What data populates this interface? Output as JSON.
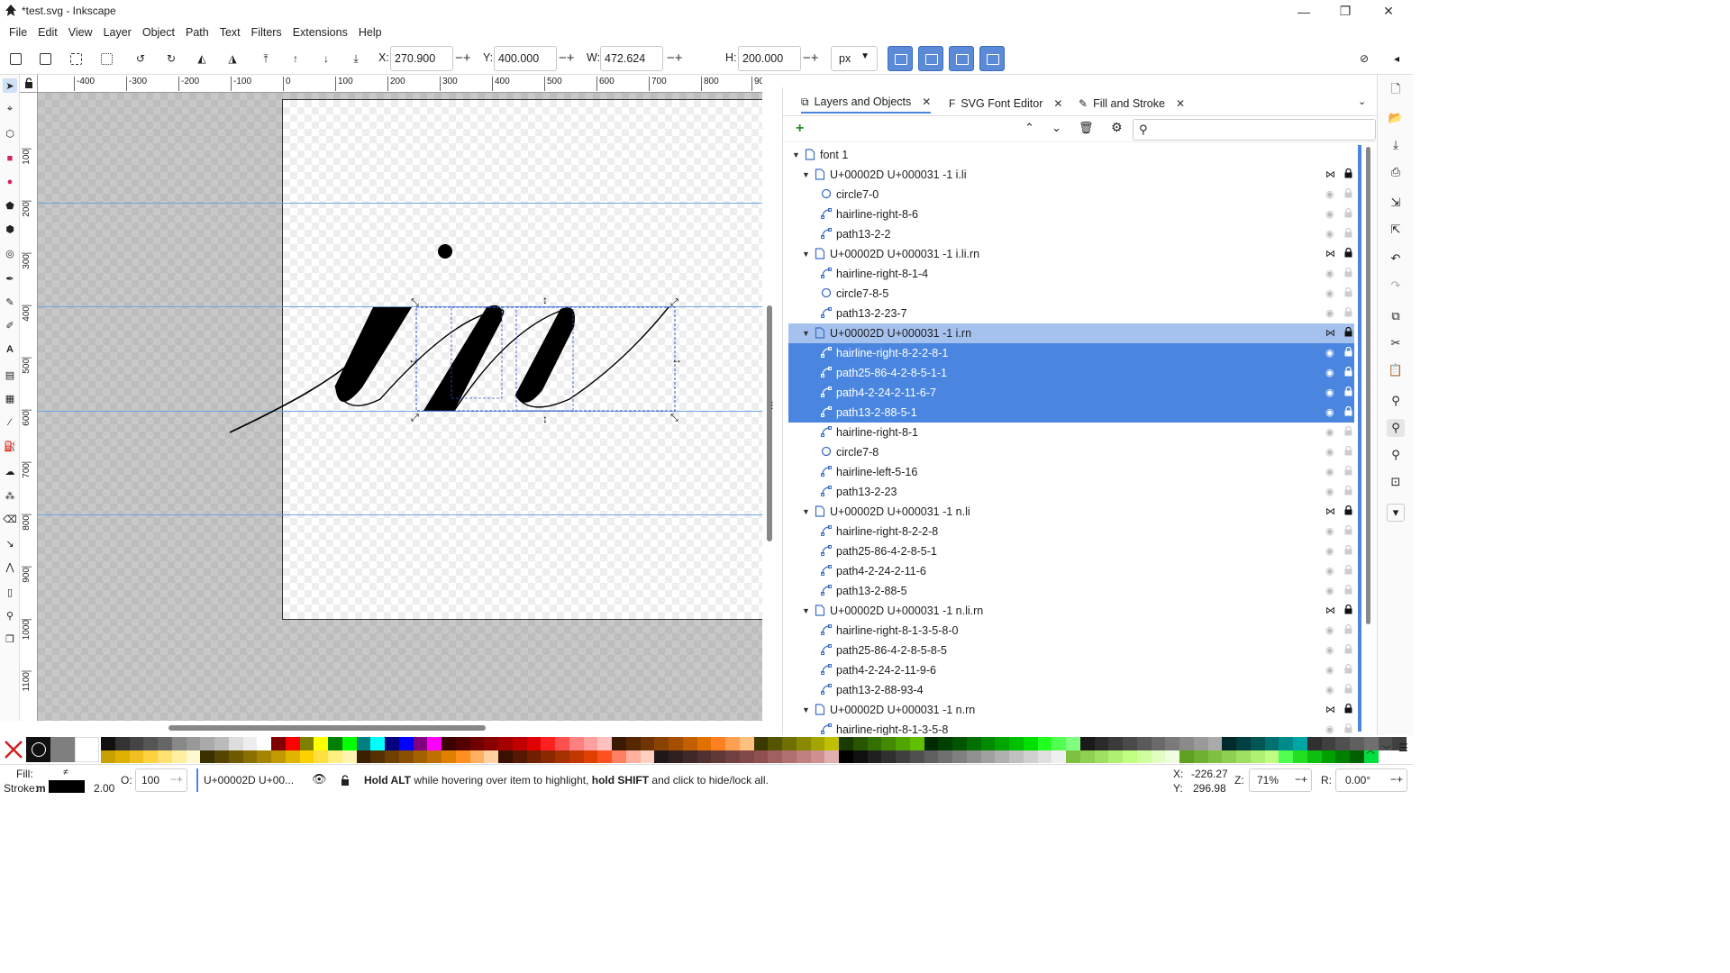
{
  "window": {
    "title": "*test.svg - Inkscape",
    "minimize": "—",
    "restore": "❐",
    "close": "✕"
  },
  "menu": [
    "File",
    "Edit",
    "View",
    "Layer",
    "Object",
    "Path",
    "Text",
    "Filters",
    "Extensions",
    "Help"
  ],
  "toolbar": {
    "x_label": "X:",
    "x_value": "270.900",
    "y_label": "Y:",
    "y_value": "400.000",
    "w_label": "W:",
    "w_value": "472.624",
    "h_label": "H:",
    "h_value": "200.000",
    "unit": "px"
  },
  "ruler": {
    "top_labels": [
      "-400",
      "-300",
      "-200",
      "-100",
      "0",
      "100",
      "200",
      "300",
      "400",
      "500",
      "600",
      "700",
      "800",
      "90"
    ],
    "left_labels": [
      "100",
      "200",
      "300",
      "400",
      "500",
      "600",
      "700",
      "800",
      "900",
      "1000",
      "1100"
    ]
  },
  "panel": {
    "tabs": [
      {
        "label": "Layers and Objects",
        "close": "✕"
      },
      {
        "label": "SVG Font Editor",
        "close": "✕"
      },
      {
        "label": "Fill and Stroke",
        "close": "✕"
      }
    ],
    "tree": [
      {
        "label": "font 1",
        "level": 0,
        "type": "layer",
        "arrow": "▼"
      },
      {
        "label": "U+00002D U+000031 -1 i.li",
        "level": 1,
        "type": "group",
        "arrow": "▼",
        "header": true
      },
      {
        "label": "circle7-0",
        "level": 2,
        "type": "circle"
      },
      {
        "label": "hairline-right-8-6",
        "level": 2,
        "type": "path"
      },
      {
        "label": "path13-2-2",
        "level": 2,
        "type": "path"
      },
      {
        "label": "U+00002D U+000031 -1 i.li.rn",
        "level": 1,
        "type": "group",
        "arrow": "▼",
        "header": true
      },
      {
        "label": "hairline-right-8-1-4",
        "level": 2,
        "type": "path"
      },
      {
        "label": "circle7-8-5",
        "level": 2,
        "type": "circle"
      },
      {
        "label": "path13-2-23-7",
        "level": 2,
        "type": "path"
      },
      {
        "label": "U+00002D U+000031 -1 i.rn",
        "level": 1,
        "type": "group",
        "arrow": "▼",
        "header": true,
        "selhead": true
      },
      {
        "label": "hairline-right-8-2-2-8-1",
        "level": 2,
        "type": "path",
        "selected": true
      },
      {
        "label": "path25-86-4-2-8-5-1-1",
        "level": 2,
        "type": "path",
        "selected": true
      },
      {
        "label": "path4-2-24-2-11-6-7",
        "level": 2,
        "type": "path",
        "selected": true
      },
      {
        "label": "path13-2-88-5-1",
        "level": 2,
        "type": "path",
        "selected": true
      },
      {
        "label": "hairline-right-8-1",
        "level": 2,
        "type": "path"
      },
      {
        "label": "circle7-8",
        "level": 2,
        "type": "circle"
      },
      {
        "label": "hairline-left-5-16",
        "level": 2,
        "type": "path"
      },
      {
        "label": "path13-2-23",
        "level": 2,
        "type": "path"
      },
      {
        "label": "U+00002D U+000031 -1 n.li",
        "level": 1,
        "type": "group",
        "arrow": "▼",
        "header": true
      },
      {
        "label": "hairline-right-8-2-2-8",
        "level": 2,
        "type": "path"
      },
      {
        "label": "path25-86-4-2-8-5-1",
        "level": 2,
        "type": "path"
      },
      {
        "label": "path4-2-24-2-11-6",
        "level": 2,
        "type": "path"
      },
      {
        "label": "path13-2-88-5",
        "level": 2,
        "type": "path"
      },
      {
        "label": "U+00002D U+000031 -1 n.li.rn",
        "level": 1,
        "type": "group",
        "arrow": "▼",
        "header": true
      },
      {
        "label": "hairline-right-8-1-3-5-8-0",
        "level": 2,
        "type": "path"
      },
      {
        "label": "path25-86-4-2-8-5-8-5",
        "level": 2,
        "type": "path"
      },
      {
        "label": "path4-2-24-2-11-9-6",
        "level": 2,
        "type": "path"
      },
      {
        "label": "path13-2-88-93-4",
        "level": 2,
        "type": "path"
      },
      {
        "label": "U+00002D U+000031 -1 n.rn",
        "level": 1,
        "type": "group",
        "arrow": "▼",
        "header": true
      },
      {
        "label": "hairline-right-8-1-3-5-8",
        "level": 2,
        "type": "path"
      }
    ]
  },
  "status": {
    "fill_label": "Fill:",
    "fill_value": "≠",
    "stroke_label": "Stroke:",
    "stroke_m": "m",
    "stroke_width": "2.00",
    "opacity_label": "O:",
    "opacity_value": "100",
    "layer_name": "U+00002D U+00...",
    "hint_b1": "Hold ALT",
    "hint_t1": " while hovering over item to highlight, ",
    "hint_b2": "hold SHIFT",
    "hint_t2": " and click to hide/lock all.",
    "cursor_x_label": "X:",
    "cursor_x": "-226.27",
    "cursor_y_label": "Y:",
    "cursor_y": "296.98",
    "zoom_label": "Z:",
    "zoom": "71%",
    "rotate_label": "R:",
    "rotate": "0.00°"
  },
  "colors": {
    "accent": "#4a86e0",
    "guide": "#6fa5e0",
    "selection": "#4a86e0"
  }
}
